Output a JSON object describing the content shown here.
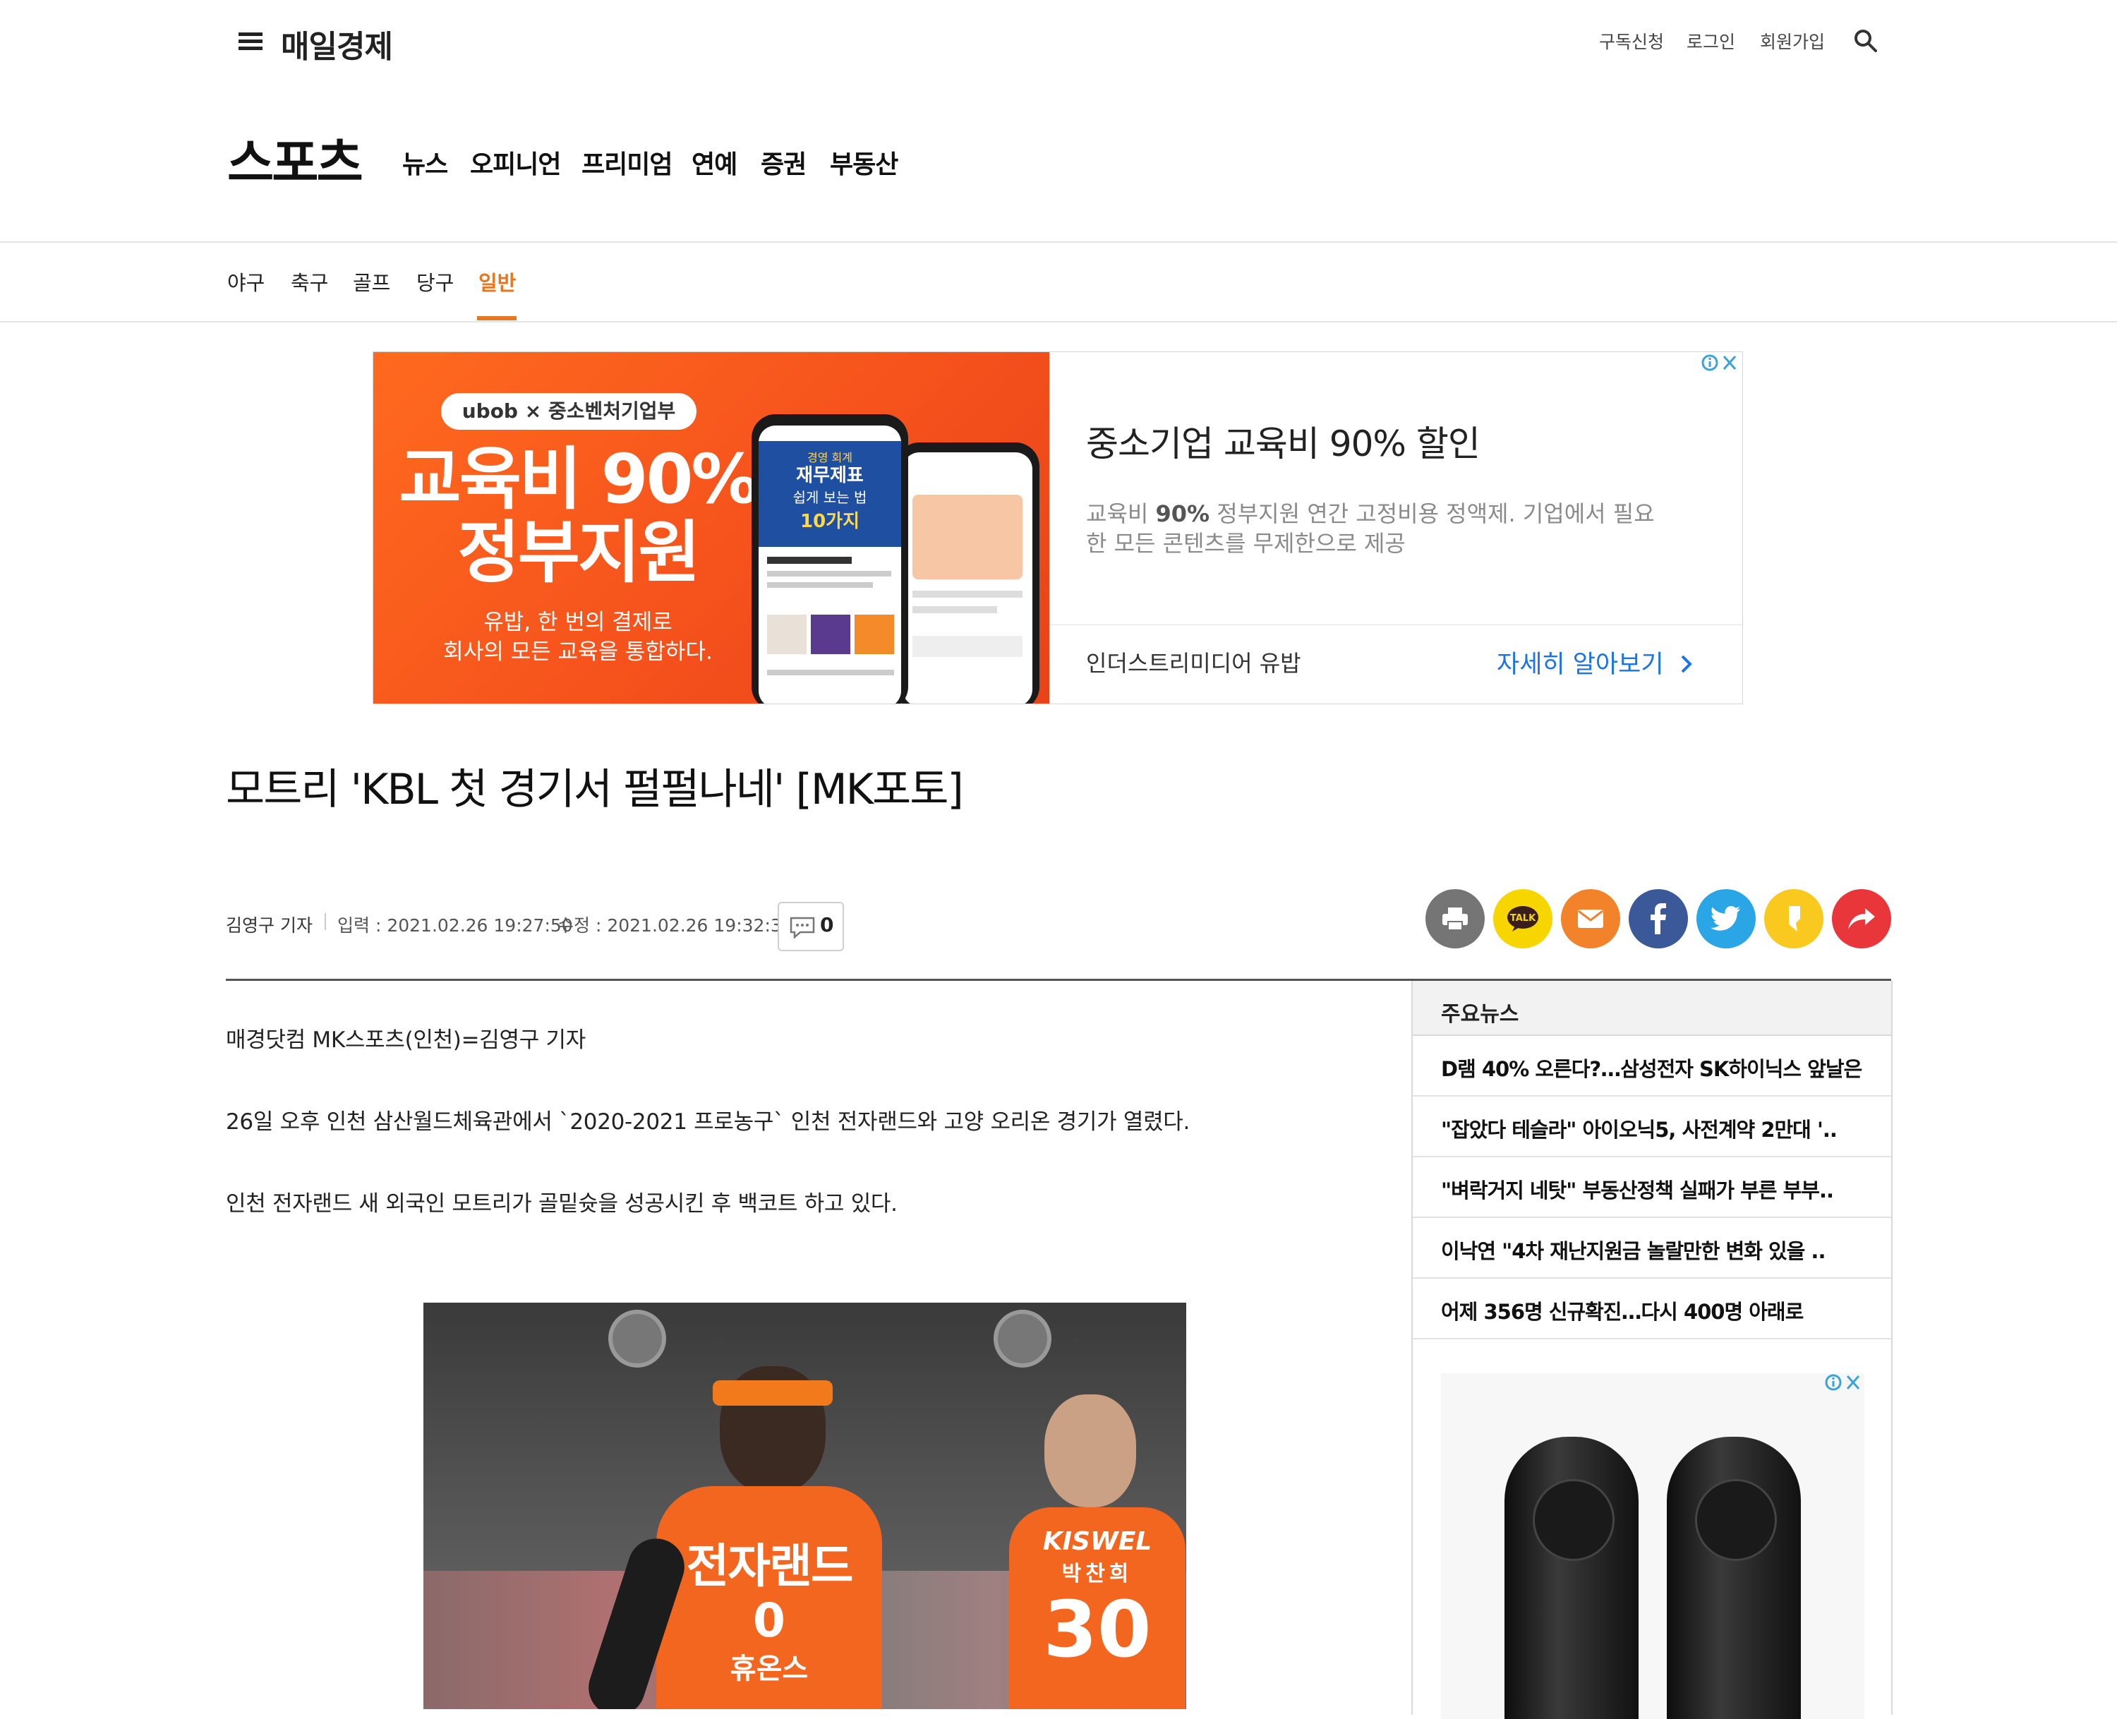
{
  "header": {
    "logo": "매일경제",
    "links": [
      "구독신청",
      "로그인",
      "회원가입"
    ]
  },
  "section": {
    "title": "스포츠",
    "nav": [
      "뉴스",
      "오피니언",
      "프리미엄",
      "연예",
      "증권",
      "부동산"
    ]
  },
  "subnav": {
    "items": [
      "야구",
      "축구",
      "골프",
      "당구",
      "일반"
    ],
    "active": "일반"
  },
  "ad": {
    "brand": "ubob × 중소벤처기업부",
    "headline_1": "교육비 90%",
    "headline_2": "정부지원",
    "sub_1": "유밥, 한 번의 결제로",
    "sub_2": "회사의 모든 교육을 통합하다.",
    "phone_label_1": "경영 회계",
    "phone_label_2": "재무제표",
    "phone_label_3": "쉽게 보는 법",
    "phone_label_4": "10가지",
    "title": "중소기업 교육비 90% 할인",
    "desc_prefix": "교육비 ",
    "desc_bold": "90%",
    "desc_rest": " 정부지원 연간 고정비용 정액제. 기업에서 필요한 모든 콘텐츠를 무제한으로 제공",
    "advertiser": "인더스트리미디어 유밥",
    "cta": "자세히 알아보기"
  },
  "article": {
    "title": "모트리 'KBL 첫 경기서 펄펄나네' [MK포토]",
    "author": "김영구 기자",
    "input_label": "입력 : 2021.02.26 19:27:50",
    "update_label": "수정 : 2021.02.26 19:32:32",
    "comment_count": "0",
    "paragraphs": [
      "매경닷컴 MK스포츠(인천)=김영구 기자",
      "26일 오후 인천 삼산월드체육관에서 `2020-2021 프로농구` 인천 전자랜드와 고양 오리온 경기가 열렸다.",
      "인천 전자랜드 새 외국인 모트리가 골밑슛을 성공시킨 후 백코트 하고 있다."
    ],
    "photo": {
      "jersey_1_team": "전자랜드",
      "jersey_1_number": "0",
      "jersey_1_sponsor": "휴온스",
      "jersey_2_sponsor": "KISWEL",
      "jersey_2_name": "박찬희",
      "jersey_2_number": "30"
    }
  },
  "share_buttons": [
    {
      "name": "print",
      "color": "#757575"
    },
    {
      "name": "kakaotalk",
      "color": "#f7d600",
      "label": "TALK"
    },
    {
      "name": "email",
      "color": "#f2832b"
    },
    {
      "name": "facebook",
      "color": "#3b5998",
      "label": "f"
    },
    {
      "name": "twitter",
      "color": "#2aa6e6"
    },
    {
      "name": "kakaostory",
      "color": "#f9c91f"
    },
    {
      "name": "share",
      "color": "#e8363b"
    }
  ],
  "sidebar": {
    "title": "주요뉴스",
    "items": [
      "D램 40% 오른다?…삼성전자 SK하이닉스 앞날은",
      "\"잡았다 테슬라\" 아이오닉5, 사전계약 2만대 '..",
      "\"벼락거지 네탓\" 부동산정책 실패가 부른 부부..",
      "이낙연 \"4차 재난지원금 놀랄만한 변화 있을 ..",
      "어제 356명 신규확진…다시 400명 아래로"
    ]
  },
  "colors": {
    "accent": "#e8761e",
    "ad_orange": "#f4501c",
    "cta_blue": "#1a73e8"
  }
}
